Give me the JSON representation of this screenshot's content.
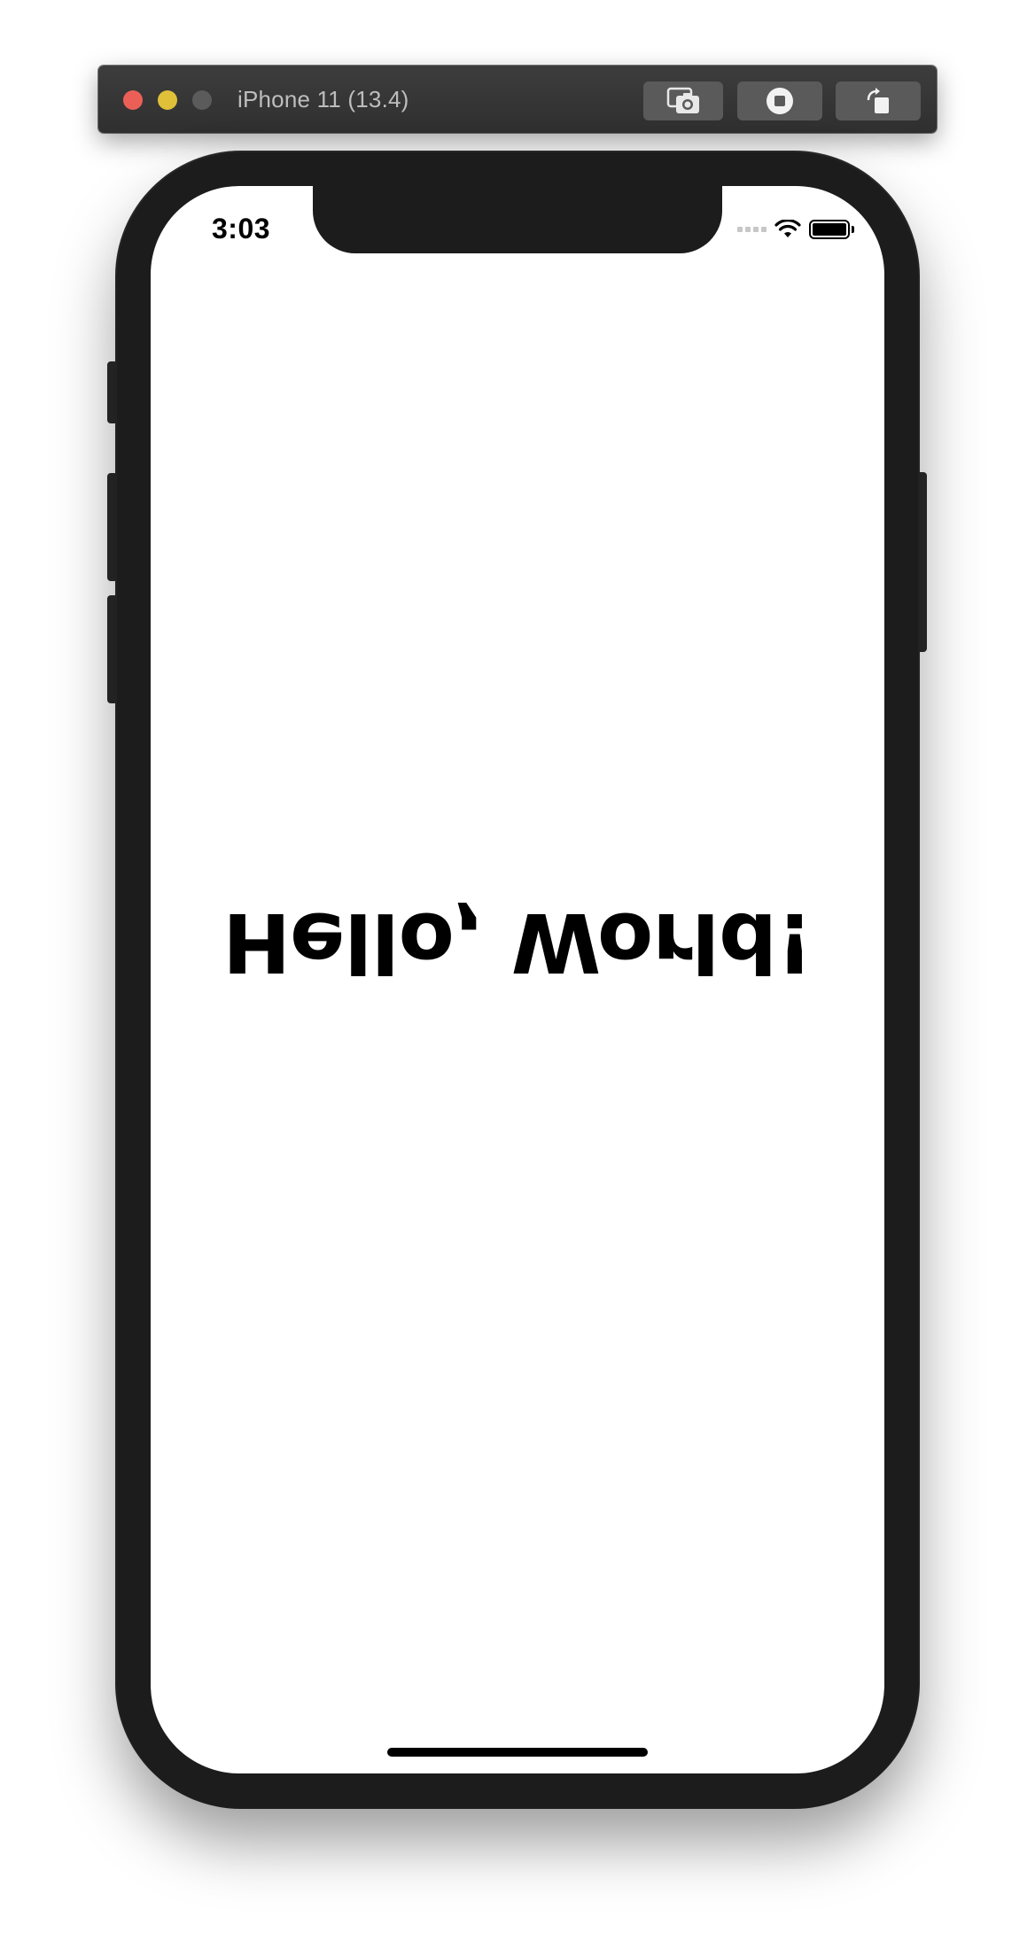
{
  "simulator": {
    "title": "iPhone 11 (13.4)",
    "buttons": [
      {
        "name": "screenshot",
        "icon": "camera-screenshot-icon"
      },
      {
        "name": "home",
        "icon": "home-button-icon"
      },
      {
        "name": "rotate",
        "icon": "rotate-icon"
      }
    ],
    "traffic_lights": {
      "close": "#ec5f57",
      "minimize": "#e0c039",
      "zoom": "#5b5b5b"
    }
  },
  "status_bar": {
    "time": "3:03",
    "icons": [
      "signal-dots-icon",
      "wifi-icon",
      "battery-icon"
    ]
  },
  "content": {
    "text": "Hello, World!",
    "orientation": "upside-down"
  },
  "colors": {
    "device_bezel": "#1c1c1c",
    "screen_background": "#ffffff",
    "text": "#000000"
  }
}
